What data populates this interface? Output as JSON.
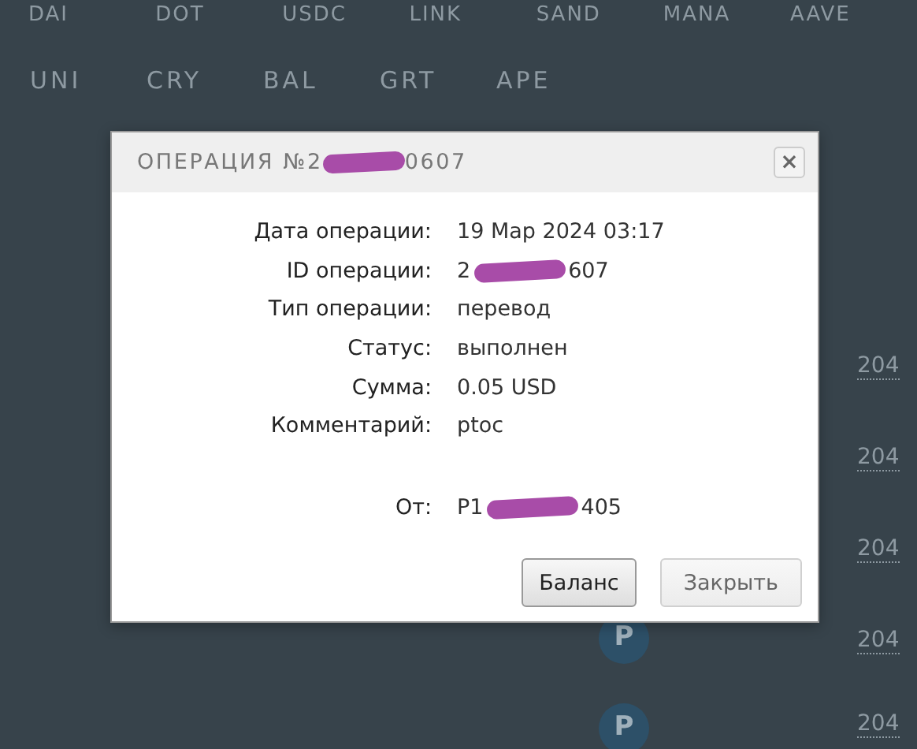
{
  "background": {
    "tokens_row_1": [
      "DAI",
      "DOT",
      "USDC",
      "LINK",
      "SAND",
      "MANA",
      "AAVE"
    ],
    "tokens_row_2": [
      "UNI",
      "CRY",
      "BAL",
      "GRT",
      "APE"
    ],
    "rows": [
      {
        "has_badge": false,
        "amount": "204"
      },
      {
        "has_badge": false,
        "amount": "204"
      },
      {
        "has_badge": false,
        "amount": "204"
      },
      {
        "has_badge": true,
        "badge": "P",
        "amount": "204"
      },
      {
        "has_badge": true,
        "badge": "P",
        "amount": "204"
      }
    ]
  },
  "modal": {
    "title": {
      "prefix": "ОПЕРАЦИЯ №2",
      "suffix": "0607",
      "redacted": true
    },
    "close": "×",
    "fields": [
      {
        "label": "Дата операции:",
        "value": "19 Мар 2024 03:17"
      },
      {
        "label": "ID операции:",
        "value_prefix": "2",
        "value": "607",
        "redacted": true
      },
      {
        "label": "Тип операции:",
        "value": "перевод"
      },
      {
        "label": "Статус:",
        "value": "выполнен"
      },
      {
        "label": "Сумма:",
        "value": "0.05 USD"
      },
      {
        "label": "Комментарий:",
        "value": "ptoc"
      },
      {
        "label": "От:",
        "value_prefix": "P1",
        "value": "405",
        "redacted": true,
        "gap_before": true
      }
    ],
    "buttons": [
      {
        "label": "Баланс",
        "primary": true
      },
      {
        "label": "Закрыть",
        "primary": false
      }
    ]
  }
}
